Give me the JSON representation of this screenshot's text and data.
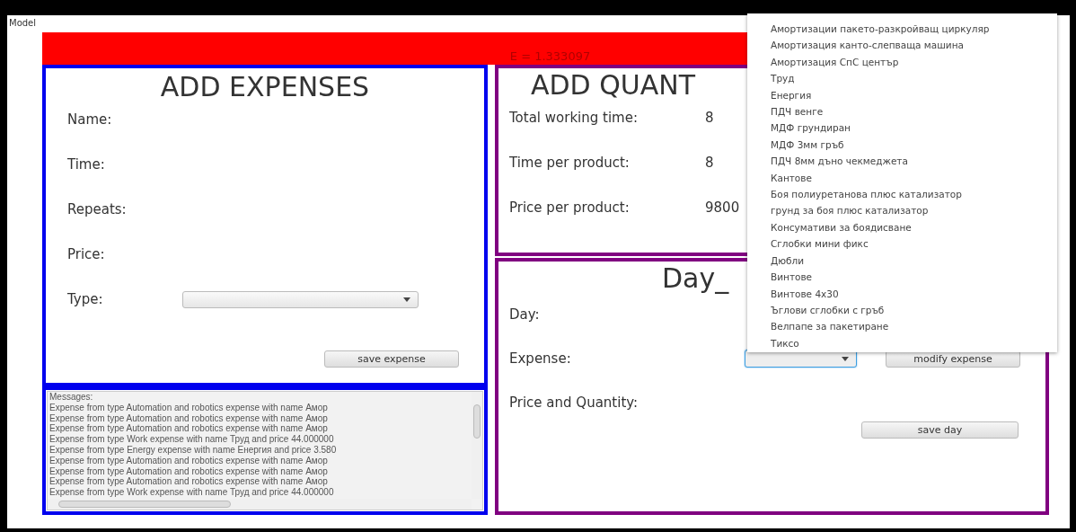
{
  "window": {
    "title": "Model"
  },
  "status_bar": {
    "text": "E = 1.333097"
  },
  "expenses_panel": {
    "title": "ADD EXPENSES",
    "fields": [
      {
        "kind": "text",
        "label": "Name:"
      },
      {
        "kind": "text",
        "label": "Time:"
      },
      {
        "kind": "text",
        "label": "Repeats:"
      },
      {
        "kind": "text",
        "label": "Price:"
      },
      {
        "kind": "combo",
        "label": "Type:"
      }
    ],
    "button": "save expense"
  },
  "messages": {
    "label": "Messages:",
    "lines": [
      "Expense from type Automation and robotics expense with name Амор",
      "Expense from type Automation and robotics expense with name Амор",
      "Expense from type Automation and robotics expense with name Амор",
      "Expense from type Work expense with name Труд and price 44.000000",
      "Expense from type Energy expense with name Енергия and price 3.580",
      "Expense from type Automation and robotics expense with name Амор",
      "Expense from type Automation and robotics expense with name Амор",
      "Expense from type Automation and robotics expense with name Амор",
      "Expense from type Work expense with name Труд and price 44.000000"
    ]
  },
  "quantity_panel": {
    "title": "ADD QUANT",
    "rows": [
      {
        "label": "Total working time:",
        "value": "8"
      },
      {
        "label": "Time per product:",
        "value": "8"
      },
      {
        "label": "Price per product:",
        "value": "9800"
      }
    ]
  },
  "day_panel": {
    "title": "Day_",
    "day_label": "Day:",
    "expense_label": "Expense:",
    "modify_button": "modify expense",
    "price_label": "Price and Quantity:",
    "save_button": "save day"
  },
  "dropdown": {
    "items": [
      "Амортизации пакето-разкройващ циркуляр",
      "Амортизация канто-слепваща машина",
      "Амортизация СпС център",
      "Труд",
      "Енергия",
      "ПДЧ венге",
      "МДФ грундиран",
      "МДФ 3мм гръб",
      "ПДЧ 8мм дъно чекмеджета",
      "Кантове",
      "Боя полиуретанова плюс катализатор",
      "грунд за боя плюс катализатор",
      "Консумативи  за боядисване",
      "Сглобки мини фикс",
      "Дюбли",
      "Винтове",
      "Винтове 4х30",
      "Ъглови сглобки с гръб",
      "Велпапе за пакетиране",
      "Тиксо"
    ]
  }
}
